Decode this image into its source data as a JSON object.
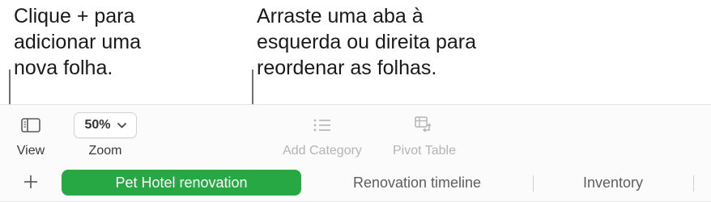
{
  "callouts": {
    "left": "Clique + para\nadicionar uma\nnova folha.",
    "right": "Arraste uma aba à\nesquerda ou direita para\nreordenar as folhas."
  },
  "toolbar": {
    "view_label": "View",
    "zoom_label": "Zoom",
    "zoom_value": "50%",
    "add_category_label": "Add Category",
    "pivot_table_label": "Pivot Table"
  },
  "sheets": {
    "add_icon": "plus-icon",
    "tabs": [
      {
        "label": "Pet Hotel renovation",
        "active": true
      },
      {
        "label": "Renovation timeline",
        "active": false
      },
      {
        "label": "Inventory",
        "active": false
      }
    ]
  },
  "colors": {
    "active_tab": "#28a745",
    "disabled_text": "#b4b4b4"
  }
}
